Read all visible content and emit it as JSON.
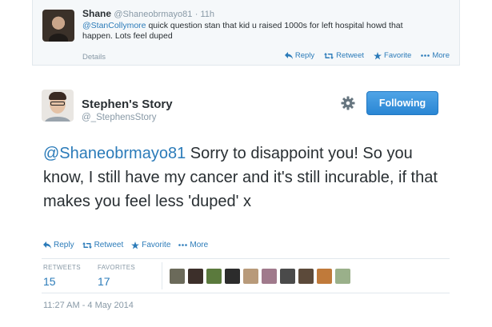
{
  "reply_tweet": {
    "name": "Shane",
    "handle": "@Shaneobrmayo81",
    "time": "· 11h",
    "mention": "@StanCollymore",
    "text": " quick question stan that kid u raised 1000s for left hospital howd that happen. Lots feel duped",
    "details": "Details",
    "actions": {
      "reply": "Reply",
      "retweet": "Retweet",
      "favorite": "Favorite",
      "more": "More"
    }
  },
  "main_tweet": {
    "name": "Stephen's Story",
    "handle": "@_StephensStory",
    "follow_label": "Following",
    "mention": "@Shaneobrmayo81",
    "text": " Sorry to disappoint you! So you know, I still have my cancer and it's still incurable, if that makes you feel less 'duped' x",
    "actions": {
      "reply": "Reply",
      "retweet": "Retweet",
      "favorite": "Favorite",
      "more": "More"
    },
    "stats": {
      "retweets_label": "RETWEETS",
      "retweets": "15",
      "favorites_label": "FAVORITES",
      "favorites": "17"
    },
    "favoriter_avatar_colors": [
      "#6b6a5a",
      "#3c2f2a",
      "#5b7a3d",
      "#2c2c2c",
      "#b89a7a",
      "#a07a8c",
      "#4a4a4a",
      "#5c4a3a",
      "#c07a3a",
      "#9ab08a"
    ],
    "timestamp": "11:27 AM - 4 May 2014"
  },
  "colors": {
    "link": "#2b7bb9",
    "muted": "#8899a6",
    "follow_button": "#3a93dc"
  }
}
